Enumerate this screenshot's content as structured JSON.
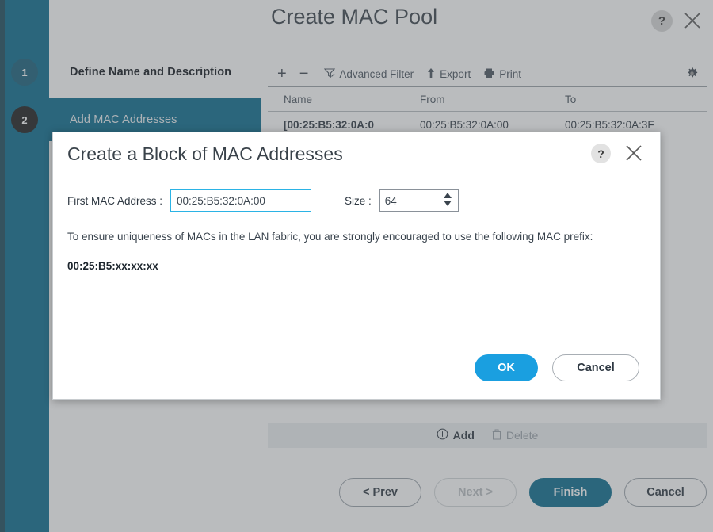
{
  "wizard": {
    "title": "Create MAC Pool",
    "help_icon": "?",
    "steps": [
      {
        "number": "1",
        "label": "Define Name and Description"
      },
      {
        "number": "2",
        "label": "Add MAC Addresses"
      }
    ],
    "toolbar": {
      "add_symbol": "+",
      "remove_symbol": "−",
      "advanced_filter": "Advanced Filter",
      "export": "Export",
      "print": "Print"
    },
    "table": {
      "columns": [
        "Name",
        "From",
        "To"
      ],
      "rows": [
        {
          "name": "[00:25:B5:32:0A:0",
          "from": "00:25:B5:32:0A:00",
          "to": "00:25:B5:32:0A:3F"
        }
      ]
    },
    "row_actions": {
      "add": "Add",
      "delete": "Delete"
    },
    "footer": {
      "prev": "< Prev",
      "next": "Next >",
      "finish": "Finish",
      "cancel": "Cancel"
    }
  },
  "modal": {
    "title": "Create a Block of MAC Addresses",
    "help_icon": "?",
    "first_mac_label": "First MAC Address :",
    "first_mac_value": "00:25:B5:32:0A:00",
    "size_label": "Size :",
    "size_value": "64",
    "description": "To ensure uniqueness of MACs in the LAN fabric, you are strongly encouraged to use the following MAC prefix:",
    "prefix": "00:25:B5:xx:xx:xx",
    "ok": "OK",
    "cancel": "Cancel"
  },
  "colors": {
    "sidebar_teal": "#0a6c8e",
    "edge_dark": "#1b4a5c",
    "ok_blue": "#1a9fe0",
    "focus_cyan": "#2bb3e5"
  }
}
